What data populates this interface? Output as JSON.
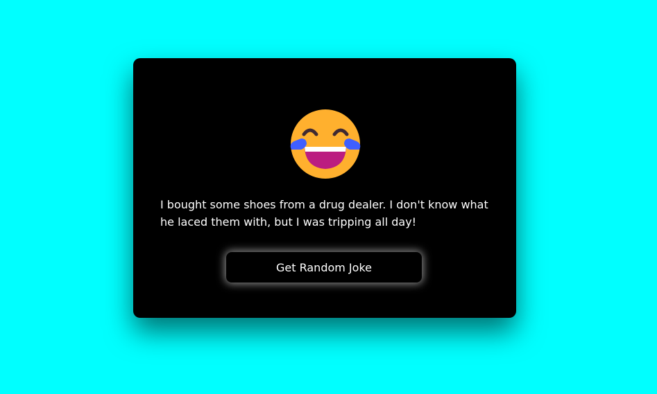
{
  "app": {
    "background_color": "#00ffff",
    "card_color": "#000000"
  },
  "joke_card": {
    "emoji_icon": "face-with-tears-of-joy-icon",
    "joke_text": "I bought some shoes from a drug dealer. I don't know what he laced them with, but I was tripping all day!",
    "button_label": "Get Random Joke"
  }
}
